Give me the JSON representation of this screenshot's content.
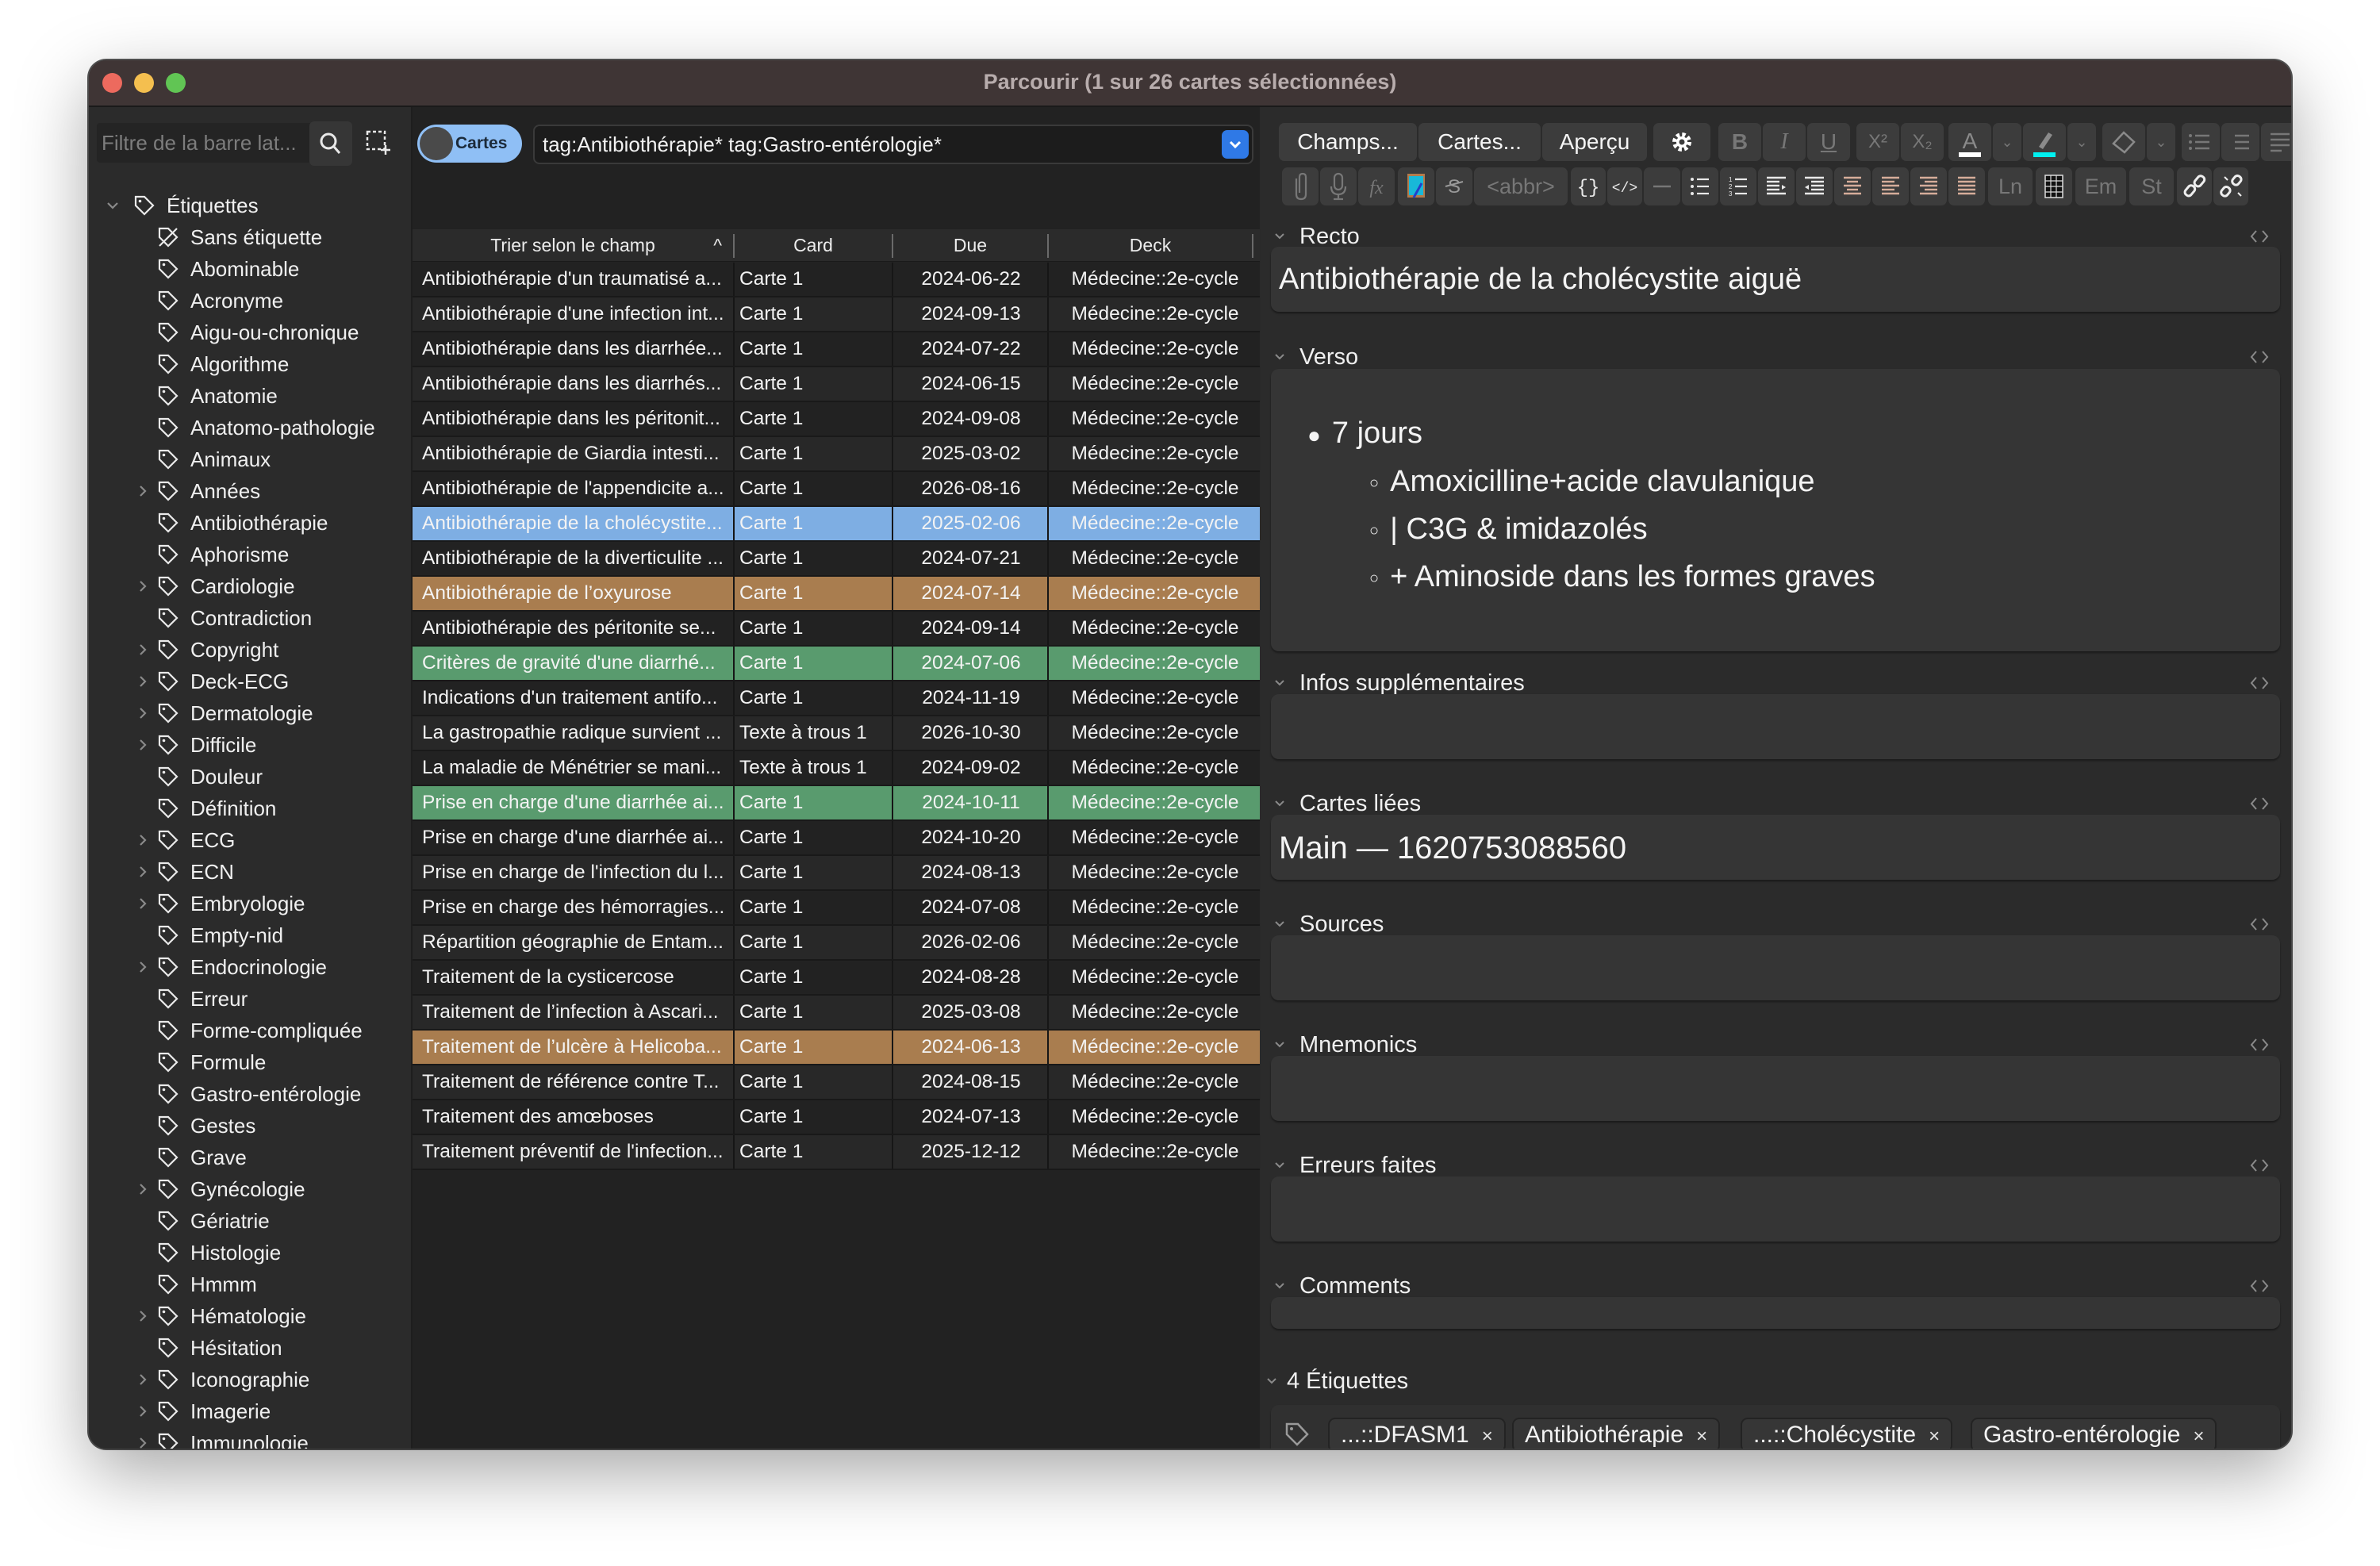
{
  "window": {
    "title": "Parcourir (1 sur 26 cartes sélectionnées)"
  },
  "sidebar": {
    "filter_placeholder": "Filtre de la barre lat...",
    "root": {
      "label": "Étiquettes",
      "expanded": true
    },
    "items": [
      {
        "label": "Sans étiquette",
        "expandable": false,
        "icon": "untagged-icon"
      },
      {
        "label": "Abominable",
        "expandable": false
      },
      {
        "label": "Acronyme",
        "expandable": false
      },
      {
        "label": "Aigu-ou-chronique",
        "expandable": false
      },
      {
        "label": "Algorithme",
        "expandable": false
      },
      {
        "label": "Anatomie",
        "expandable": false
      },
      {
        "label": "Anatomo-pathologie",
        "expandable": false
      },
      {
        "label": "Animaux",
        "expandable": false
      },
      {
        "label": "Années",
        "expandable": true
      },
      {
        "label": "Antibiothérapie",
        "expandable": false
      },
      {
        "label": "Aphorisme",
        "expandable": false
      },
      {
        "label": "Cardiologie",
        "expandable": true
      },
      {
        "label": "Contradiction",
        "expandable": false
      },
      {
        "label": "Copyright",
        "expandable": true
      },
      {
        "label": "Deck-ECG",
        "expandable": true
      },
      {
        "label": "Dermatologie",
        "expandable": true
      },
      {
        "label": "Difficile",
        "expandable": true
      },
      {
        "label": "Douleur",
        "expandable": false
      },
      {
        "label": "Définition",
        "expandable": false
      },
      {
        "label": "ECG",
        "expandable": true
      },
      {
        "label": "ECN",
        "expandable": true
      },
      {
        "label": "Embryologie",
        "expandable": true
      },
      {
        "label": "Empty-nid",
        "expandable": false
      },
      {
        "label": "Endocrinologie",
        "expandable": true
      },
      {
        "label": "Erreur",
        "expandable": false
      },
      {
        "label": "Forme-compliquée",
        "expandable": false
      },
      {
        "label": "Formule",
        "expandable": false
      },
      {
        "label": "Gastro-entérologie",
        "expandable": false
      },
      {
        "label": "Gestes",
        "expandable": false
      },
      {
        "label": "Grave",
        "expandable": false
      },
      {
        "label": "Gynécologie",
        "expandable": true
      },
      {
        "label": "Gériatrie",
        "expandable": false
      },
      {
        "label": "Histologie",
        "expandable": false
      },
      {
        "label": "Hmmm",
        "expandable": false
      },
      {
        "label": "Hématologie",
        "expandable": true
      },
      {
        "label": "Hésitation",
        "expandable": false
      },
      {
        "label": "Iconographie",
        "expandable": true
      },
      {
        "label": "Imagerie",
        "expandable": true
      },
      {
        "label": "Immunologie",
        "expandable": true
      }
    ]
  },
  "browser": {
    "mode_toggle_label": "Cartes",
    "search_value": "tag:Antibiothérapie* tag:Gastro-entérologie*",
    "columns": [
      "Trier selon le champ",
      "Card",
      "Due",
      "Deck"
    ],
    "sort_indicator": "^",
    "row_colors": {
      "selected": "#7eaee3",
      "flagged_orange": "#a97d4f",
      "flagged_green": "#599b6e",
      "even": "#222222",
      "odd": "#282828"
    },
    "rows": [
      {
        "field": "Antibiothérapie d'un traumatisé a...",
        "card": "Carte 1",
        "due": "2024-06-22",
        "deck": "Médecine::2e-cycle",
        "state": "normal"
      },
      {
        "field": "Antibiothérapie d'une infection int...",
        "card": "Carte 1",
        "due": "2024-09-13",
        "deck": "Médecine::2e-cycle",
        "state": "normal"
      },
      {
        "field": "Antibiothérapie dans les diarrhée...",
        "card": "Carte 1",
        "due": "2024-07-22",
        "deck": "Médecine::2e-cycle",
        "state": "normal"
      },
      {
        "field": "Antibiothérapie dans les diarrhés...",
        "card": "Carte 1",
        "due": "2024-06-15",
        "deck": "Médecine::2e-cycle",
        "state": "normal"
      },
      {
        "field": "Antibiothérapie dans les péritonit...",
        "card": "Carte 1",
        "due": "2024-09-08",
        "deck": "Médecine::2e-cycle",
        "state": "normal"
      },
      {
        "field": "Antibiothérapie de Giardia intesti...",
        "card": "Carte 1",
        "due": "2025-03-02",
        "deck": "Médecine::2e-cycle",
        "state": "normal"
      },
      {
        "field": "Antibiothérapie de l'appendicite a...",
        "card": "Carte 1",
        "due": "2026-08-16",
        "deck": "Médecine::2e-cycle",
        "state": "normal"
      },
      {
        "field": "Antibiothérapie de la cholécystite...",
        "card": "Carte 1",
        "due": "2025-02-06",
        "deck": "Médecine::2e-cycle",
        "state": "selected"
      },
      {
        "field": "Antibiothérapie de la diverticulite ...",
        "card": "Carte 1",
        "due": "2024-07-21",
        "deck": "Médecine::2e-cycle",
        "state": "normal"
      },
      {
        "field": "Antibiothérapie de l’oxyurose",
        "card": "Carte 1",
        "due": "2024-07-14",
        "deck": "Médecine::2e-cycle",
        "state": "flagged_orange"
      },
      {
        "field": "Antibiothérapie des péritonite se...",
        "card": "Carte 1",
        "due": "2024-09-14",
        "deck": "Médecine::2e-cycle",
        "state": "normal"
      },
      {
        "field": "Critères de gravité d'une diarrhé...",
        "card": "Carte 1",
        "due": "2024-07-06",
        "deck": "Médecine::2e-cycle",
        "state": "flagged_green"
      },
      {
        "field": "Indications d'un traitement antifo...",
        "card": "Carte 1",
        "due": "2024-11-19",
        "deck": "Médecine::2e-cycle",
        "state": "normal"
      },
      {
        "field": "La gastropathie radique survient ...",
        "card": "Texte à trous 1",
        "due": "2026-10-30",
        "deck": "Médecine::2e-cycle",
        "state": "normal"
      },
      {
        "field": "La maladie de Ménétrier se mani...",
        "card": "Texte à trous 1",
        "due": "2024-09-02",
        "deck": "Médecine::2e-cycle",
        "state": "normal"
      },
      {
        "field": "Prise en charge d'une diarrhée ai...",
        "card": "Carte 1",
        "due": "2024-10-11",
        "deck": "Médecine::2e-cycle",
        "state": "flagged_green"
      },
      {
        "field": "Prise en charge d'une diarrhée ai...",
        "card": "Carte 1",
        "due": "2024-10-20",
        "deck": "Médecine::2e-cycle",
        "state": "normal"
      },
      {
        "field": "Prise en charge de l'infection du l...",
        "card": "Carte 1",
        "due": "2024-08-13",
        "deck": "Médecine::2e-cycle",
        "state": "normal"
      },
      {
        "field": "Prise en charge des hémorragies...",
        "card": "Carte 1",
        "due": "2024-07-08",
        "deck": "Médecine::2e-cycle",
        "state": "normal"
      },
      {
        "field": "Répartition géographie de Entam...",
        "card": "Carte 1",
        "due": "2026-02-06",
        "deck": "Médecine::2e-cycle",
        "state": "normal"
      },
      {
        "field": "Traitement de la cysticercose",
        "card": "Carte 1",
        "due": "2024-08-28",
        "deck": "Médecine::2e-cycle",
        "state": "normal"
      },
      {
        "field": "Traitement de l’infection à Ascari...",
        "card": "Carte 1",
        "due": "2025-03-08",
        "deck": "Médecine::2e-cycle",
        "state": "normal"
      },
      {
        "field": "Traitement de l’ulcère à Helicoba...",
        "card": "Carte 1",
        "due": "2024-06-13",
        "deck": "Médecine::2e-cycle",
        "state": "flagged_orange"
      },
      {
        "field": "Traitement de référence contre T...",
        "card": "Carte 1",
        "due": "2024-08-15",
        "deck": "Médecine::2e-cycle",
        "state": "normal"
      },
      {
        "field": "Traitement des amœboses",
        "card": "Carte 1",
        "due": "2024-07-13",
        "deck": "Médecine::2e-cycle",
        "state": "normal"
      },
      {
        "field": "Traitement préventif de l'infection...",
        "card": "Carte 1",
        "due": "2025-12-12",
        "deck": "Médecine::2e-cycle",
        "state": "normal"
      }
    ]
  },
  "editor": {
    "toolbar1": {
      "fields_button": "Champs...",
      "cards_button": "Cartes...",
      "preview_button": "Aperçu",
      "bold": "B",
      "italic": "I",
      "underline": "U",
      "superscript": "X²",
      "subscript": "X₂",
      "text_color": "#ffffff",
      "highlight_color": "#00ffff"
    },
    "toolbar2": {
      "abbr": "<abbr>",
      "ln": "Ln",
      "em": "Em",
      "st": "St"
    },
    "fields": [
      {
        "name": "Recto",
        "content": "Antibiothérapie de la cholécystite aiguë"
      },
      {
        "name": "Verso",
        "list": {
          "item": "7 jours",
          "subitems": [
            "Amoxicilline+acide clavulanique",
            "| C3G & imidazolés",
            "+ Aminoside dans les formes graves"
          ]
        }
      },
      {
        "name": "Infos supplémentaires",
        "content": ""
      },
      {
        "name": "Cartes liées",
        "content": "Main — 1620753088560"
      },
      {
        "name": "Sources",
        "content": ""
      },
      {
        "name": "Mnemonics",
        "content": ""
      },
      {
        "name": "Erreurs faites",
        "content": ""
      },
      {
        "name": "Comments",
        "content": ""
      }
    ],
    "tags": {
      "header": "4 Étiquettes",
      "items": [
        "...::DFASM1",
        "Antibiothérapie",
        "...::Cholécystite",
        "Gastro-entérologie"
      ],
      "remove_glyph": "×"
    }
  }
}
